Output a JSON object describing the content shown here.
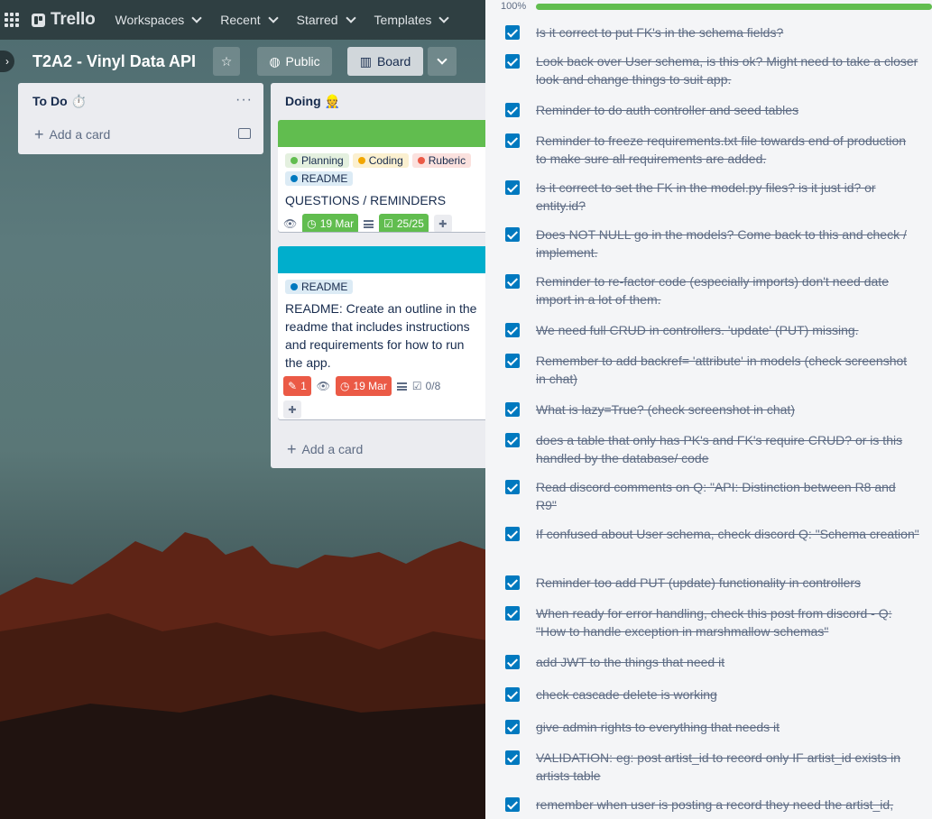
{
  "topnav": {
    "logo": "Trello",
    "menus": [
      "Workspaces",
      "Recent",
      "Starred",
      "Templates"
    ]
  },
  "board": {
    "title": "T2A2 - Vinyl Data API",
    "visibility": "Public",
    "view": "Board"
  },
  "lists": [
    {
      "name": "To Do ⏱️",
      "add_card": "Add a card"
    },
    {
      "name": "Doing 👷",
      "add_card": "Add a card"
    }
  ],
  "cards": [
    {
      "cover_color": "#61bd4f",
      "labels": [
        {
          "text": "Planning",
          "color": "#61bd4f",
          "bg": "#e4f0df"
        },
        {
          "text": "Coding",
          "color": "#f2d600",
          "bg": "#fbf0d0"
        },
        {
          "text": "Ruberic",
          "color": "#eb5a46",
          "bg": "#fbe1de"
        },
        {
          "text": "README",
          "color": "#0079bf",
          "bg": "#dcebf5"
        }
      ],
      "title": "QUESTIONS / REMINDERS",
      "due": "19 Mar",
      "checklist": "25/25"
    },
    {
      "cover_color": "#00aecc",
      "labels": [
        {
          "text": "README",
          "color": "#0079bf",
          "bg": "#dcebf5"
        }
      ],
      "title": "README: Create an outline in the readme that includes instructions and requirements for how to run the app.",
      "comments": "1",
      "due": "19 Mar",
      "checklist": "0/8"
    }
  ],
  "checklist": {
    "progress": 1.0,
    "progress_text": "100%",
    "items": [
      "Is it correct to put FK's in the schema fields?",
      "Look back over User schema, is this ok? Might need to take a closer look and change things to suit app.",
      "Reminder to do auth controller and seed tables",
      "Reminder to freeze requirements.txt file towards end of production to make sure all requirements are added.",
      "Is it correct to set the FK in the model.py files? is it just id? or entity.id?",
      "Does NOT NULL go in the models? Come back to this and check / implement.",
      "Reminder to re-factor code (especially imports) don't need date import in a lot of them.",
      "We need full CRUD in controllers. 'update' (PUT) missing.",
      "Remember to add backref= 'attribute' in models (check screenshot in chat)",
      "What is lazy=True? (check screenshot in chat)",
      "does a table that only has PK's and FK's require CRUD? or is this handled by the database/ code",
      "Read discord comments on Q: \"API: Distinction between R8 and R9\"",
      "If confused about User schema, check discord Q: \"Schema creation\"",
      "Reminder too add PUT (update) functionality in controllers",
      "When ready for error handling, check this post from discord - Q: \"How to handle exception in marshmallow schemas\"",
      "add JWT to the things that need it",
      "check cascade delete is working",
      "give admin rights to everything that needs it",
      "VALIDATION: eg: post artist_id to record only IF artist_id exists in artists table",
      "remember when user is posting a record they need the artist_id,"
    ]
  },
  "colors": {
    "checkbox": "#0079bf",
    "progress": "#61bd4f",
    "due_complete": "#61bd4f",
    "due_overdue": "#eb5a46"
  }
}
